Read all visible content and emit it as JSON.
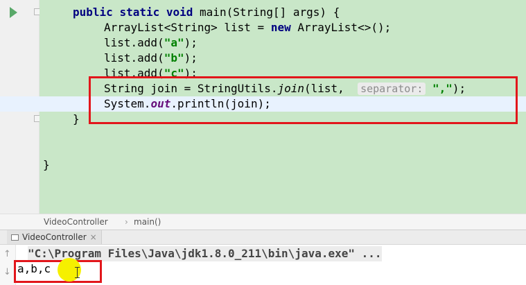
{
  "editor": {
    "lines": {
      "l1": {
        "kw1": "public",
        "kw2": "static",
        "kw3": "void",
        "text": " main(String[] args) {"
      },
      "l2": {
        "pre": "ArrayList<String> list = ",
        "kw": "new",
        "post": " ArrayList<>();"
      },
      "l3": {
        "pre": "list.add(",
        "str": "\"a\"",
        "post": ");"
      },
      "l4": {
        "pre": "list.add(",
        "str": "\"b\"",
        "post": ");"
      },
      "l5": {
        "pre": "list.add(",
        "str": "\"c\"",
        "post": ");"
      },
      "l6": {
        "pre": "String join = StringUtils.",
        "method": "join",
        "mid": "(list, ",
        "hint": "separator:",
        "str": "\",\"",
        "post": ");"
      },
      "l7": {
        "pre": "System.",
        "field": "out",
        "post": ".println(join);"
      },
      "l8": {
        "text": "}"
      },
      "l9": {
        "text": "}"
      }
    }
  },
  "breadcrumb": {
    "class_name": "VideoController",
    "separator": "›",
    "method": "main()"
  },
  "run_panel": {
    "tab_label": "VideoController",
    "tab_close": "×",
    "command": "\"C:\\Program Files\\Java\\jdk1.8.0_211\\bin\\java.exe\" ...",
    "output": "a,b,c",
    "up_arrow": "↑",
    "down_arrow": "↓"
  },
  "colors": {
    "code_highlight": "#c9e7c8",
    "annotation_box": "#e2161b",
    "keyword": "#000080",
    "string": "#008000",
    "cursor_highlight": "#f6f000"
  }
}
